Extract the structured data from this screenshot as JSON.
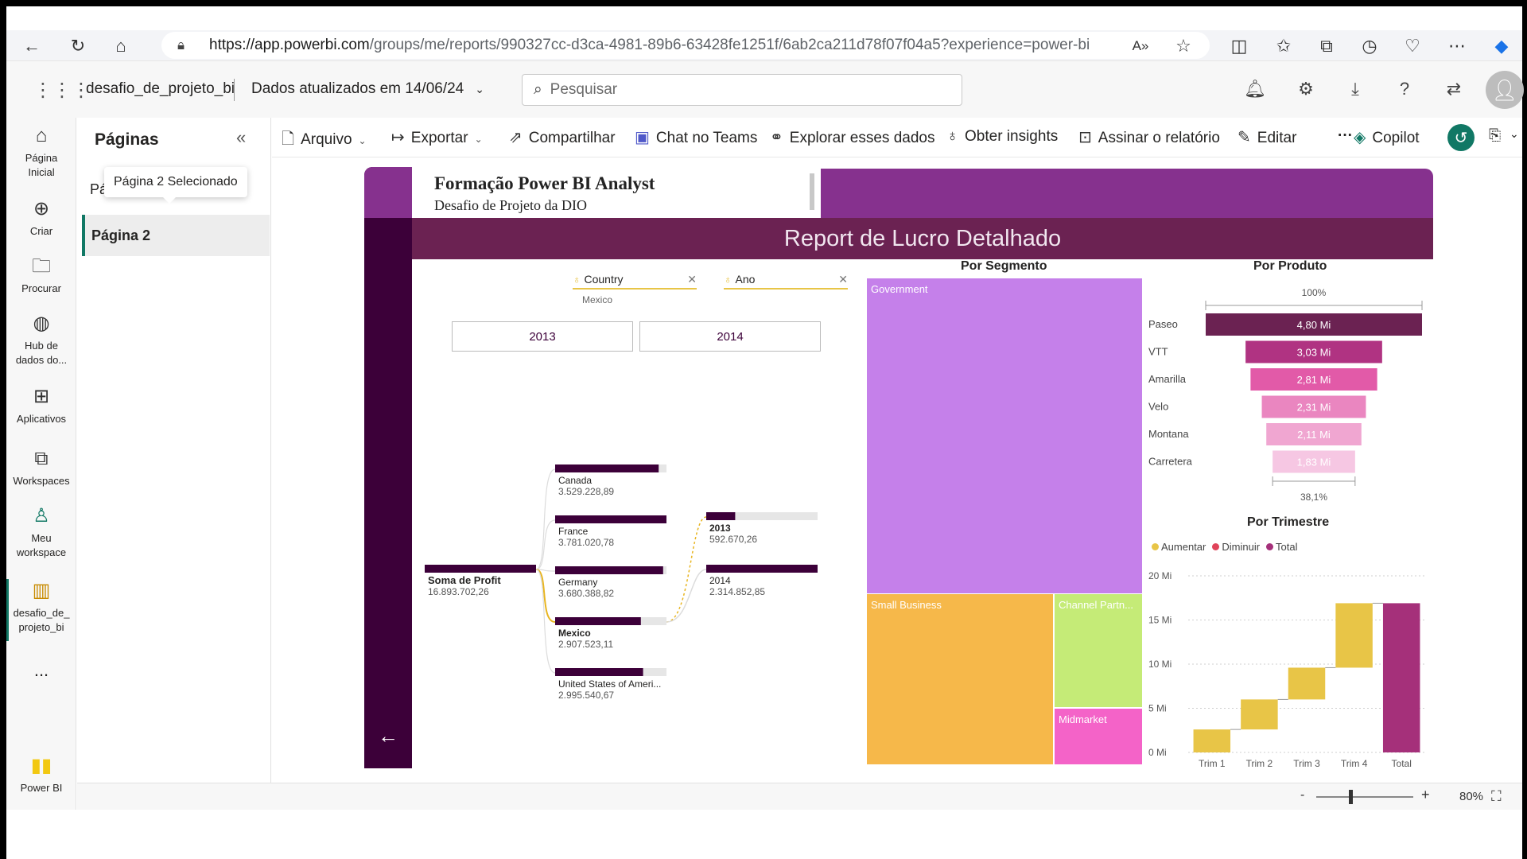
{
  "browser": {
    "url_host": "https://app.powerbi.com",
    "url_path": "/groups/me/reports/990327cc-d3ca-4981-89b6-63428fe1251f/6ab2ca211d78f07f04a5?experience=power-bi"
  },
  "header": {
    "workspace": "desafio_de_projeto_bi",
    "refresh": "Dados atualizados em 14/06/24",
    "search_placeholder": "Pesquisar"
  },
  "leftnav": {
    "items": [
      {
        "label": "Página\nInicial",
        "icon": "home-icon"
      },
      {
        "label": "Criar",
        "icon": "plus-circle-icon"
      },
      {
        "label": "Procurar",
        "icon": "folder-icon"
      },
      {
        "label": "Hub de\ndados do...",
        "icon": "data-hub-icon"
      },
      {
        "label": "Aplicativos",
        "icon": "apps-icon"
      },
      {
        "label": "Workspaces",
        "icon": "workspaces-icon"
      },
      {
        "label": "Meu\nworkspace",
        "icon": "person-icon"
      },
      {
        "label": "desafio_de_\nprojeto_bi",
        "icon": "report-icon"
      }
    ],
    "more": "...",
    "brand": "Power BI"
  },
  "pages": {
    "title": "Páginas",
    "page1": "Pá",
    "tooltip": "Página 2 Selecionado",
    "page2": "Página 2"
  },
  "toolbar": {
    "arquivo": "Arquivo",
    "exportar": "Exportar",
    "compartilhar": "Compartilhar",
    "chat": "Chat no Teams",
    "explorar": "Explorar esses dados",
    "insights": "Obter insights",
    "assinar": "Assinar o relatório",
    "editar": "Editar",
    "more": "···",
    "copilot": "Copilot"
  },
  "status": {
    "zoom_minus": "-",
    "zoom_plus": "+",
    "zoom": "80%"
  },
  "report": {
    "title": "Formação Power BI Analyst",
    "subtitle": "Desafio de Projeto da DIO",
    "banner": "Report de Lucro Detalhado",
    "slicers": [
      {
        "label": "Country",
        "value": "Mexico"
      },
      {
        "label": "Ano",
        "value": ""
      }
    ],
    "years": [
      "2013",
      "2014"
    ],
    "decomp": {
      "root": {
        "label": "Soma de Profit",
        "value": "16.893.702,26"
      },
      "countries": [
        {
          "label": "Canada",
          "value": "3.529.228,89",
          "fill": 0.93
        },
        {
          "label": "France",
          "value": "3.781.020,78",
          "fill": 1.0
        },
        {
          "label": "Germany",
          "value": "3.680.388,82",
          "fill": 0.97
        },
        {
          "label": "Mexico",
          "value": "2.907.523,11",
          "fill": 0.77,
          "selected": true
        },
        {
          "label": "United States of Ameri...",
          "value": "2.995.540,67",
          "fill": 0.79
        }
      ],
      "years": [
        {
          "label": "2013",
          "value": "592.670,26",
          "fill": 0.26,
          "selected": true
        },
        {
          "label": "2014",
          "value": "2.314.852,85",
          "fill": 1.0
        }
      ]
    },
    "segment": {
      "title": "Por Segmento",
      "items": [
        {
          "label": "Government",
          "color": "#c580ea"
        },
        {
          "label": "Small Business",
          "color": "#f6b84a"
        },
        {
          "label": "Channel Partn...",
          "color": "#c5eb77"
        },
        {
          "label": "Midmarket",
          "color": "#f463c8"
        }
      ]
    },
    "produto": {
      "title": "Por Produto",
      "top_pct": "100%",
      "bottom_pct": "38,1%",
      "items": [
        {
          "label": "Paseo",
          "value": "4,80 Mi",
          "v": 4.8,
          "color": "#6b2252"
        },
        {
          "label": "VTT",
          "value": "3,03 Mi",
          "v": 3.03,
          "color": "#b03382"
        },
        {
          "label": "Amarilla",
          "value": "2,81 Mi",
          "v": 2.81,
          "color": "#e25aa8"
        },
        {
          "label": "Velo",
          "value": "2,31 Mi",
          "v": 2.31,
          "color": "#ea86c0"
        },
        {
          "label": "Montana",
          "value": "2,11 Mi",
          "v": 2.11,
          "color": "#f0a6d1"
        },
        {
          "label": "Carretera",
          "value": "1,83 Mi",
          "v": 1.83,
          "color": "#f6c7e3"
        }
      ]
    }
  },
  "chart_data": {
    "type": "bar",
    "title": "Por Trimestre",
    "subtype": "waterfall",
    "legend": [
      {
        "name": "Aumentar",
        "color": "#e8c547"
      },
      {
        "name": "Diminuir",
        "color": "#e0445a"
      },
      {
        "name": "Total",
        "color": "#a5307a"
      }
    ],
    "legend_position": "top-left",
    "categories": [
      "Trim 1",
      "Trim 2",
      "Trim 3",
      "Trim 4",
      "Total"
    ],
    "values": [
      2.6,
      3.4,
      3.6,
      7.3,
      16.9
    ],
    "y_ticks": [
      "0 Mi",
      "5 Mi",
      "10 Mi",
      "15 Mi",
      "20 Mi"
    ],
    "ylim": [
      0,
      20
    ],
    "grid": true
  }
}
